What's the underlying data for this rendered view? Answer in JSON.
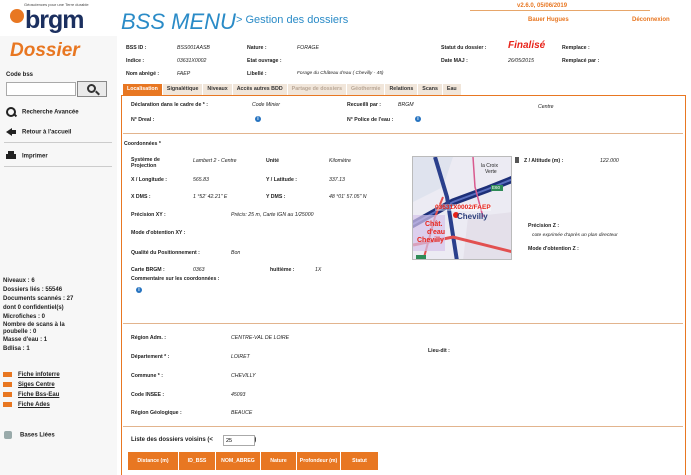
{
  "header": {
    "logo_tagline": "Géosciences pour une Terre durable",
    "logo_text": "brgm",
    "app_title": "BSS MENU",
    "app_subtitle": "> Gestion des dossiers",
    "version": "v2.6.0, 05/06/2019",
    "user": "Bauer Hugues",
    "logout": "Déconnexion"
  },
  "sidebar": {
    "title": "Dossier",
    "codebss_label": "Code bss",
    "codebss_value": "",
    "links": [
      {
        "label": "Recherche Avancée",
        "icon": "search-icon"
      },
      {
        "label": "Retour à l'accueil",
        "icon": "back-arrow-icon"
      },
      {
        "label": "Imprimer",
        "icon": "printer-icon"
      }
    ],
    "stats": [
      "Niveaux : 6",
      "Dossiers liés : 55546",
      "Documents scannés : 27",
      "dont 0 confidentiel(s)",
      "Microfiches : 0",
      "Nombre de scans à la",
      "poubelle : 0",
      "Masse d'eau : 1",
      "Bdlisa : 1"
    ],
    "ext_links": [
      "Fiche infoterre",
      "Siges Centre",
      "Fiche Bss-Eau",
      "Fiche Ades"
    ],
    "bases_label": "Bases Liées"
  },
  "record": {
    "bss_id_label": "BSS ID :",
    "bss_id": "BSS001AASB",
    "indice_label": "Indice :",
    "indice": "03631X0002",
    "nom_label": "Nom abrégé :",
    "nom": "FAEP",
    "nature_label": "Nature :",
    "nature": "FORAGE",
    "etat_label": "Etat ouvrage :",
    "etat": "",
    "libelle_label": "Libellé :",
    "libelle": "Forage du Château d'eau ( Chevilly - 45)",
    "statut_label": "Statut du dossier :",
    "statut": "Finalisé",
    "datemaj_label": "Date MAJ :",
    "datemaj": "26/05/2015",
    "remplace_label": "Remplace :",
    "remplace_par_label": "Remplacé par :"
  },
  "tabs": [
    {
      "label": "Localisation",
      "state": "active"
    },
    {
      "label": "Signalétique",
      "state": "normal"
    },
    {
      "label": "Niveaux",
      "state": "normal"
    },
    {
      "label": "Accès autres BDD",
      "state": "normal"
    },
    {
      "label": "Partage de dossiers",
      "state": "disabled"
    },
    {
      "label": "Géothermie",
      "state": "disabled"
    },
    {
      "label": "Relations",
      "state": "normal"
    },
    {
      "label": "Scans",
      "state": "normal"
    },
    {
      "label": "Eau",
      "state": "normal"
    }
  ],
  "localisation": {
    "declaration_label": "Déclaration dans le cadre de * :",
    "declaration": "Code Minier",
    "recueilli_label": "Recueilli par :",
    "recueilli": "BRGM",
    "recueilli_extra": "Centre",
    "dreal_label": "N° Dreal :",
    "police_label": "N° Police de l'eau :",
    "coord_title": "Coordonnées *",
    "systeme_label": "Système de Projection",
    "systeme": "Lambert 2 - Centre",
    "unite_label": "Unité",
    "unite": "Kilomètre",
    "x_label": "X / Longitude :",
    "x": "565.83",
    "y_label": "Y / Latitude :",
    "y": "337.13",
    "xdms_label": "X DMS :",
    "xdms": "1 °52' 42.21\" E",
    "ydms_label": "Y DMS :",
    "ydms": "48 °01' 57.05\" N",
    "precision_xy_label": "Précision XY :",
    "precision_xy": "Précis: 25 m, Carte IGN au 1/25000",
    "mode_xy_label": "Mode d'obtention XY :",
    "qualite_label": "Qualité du Positionnement :",
    "qualite": "Bon",
    "carte_label": "Carte BRGM :",
    "carte": "0363",
    "huitieme_label": "huitième :",
    "huitieme": "1X",
    "commentaire_label": "Commentaire sur les coordonnées :",
    "z_label": "Z / Altitude (m) :",
    "z": "122.000",
    "precision_z_label": "Précision Z :",
    "precision_z": "cote exprimée d'après un plan directeur",
    "mode_z_label": "Mode d'obtention Z :",
    "map_labels": {
      "place1": "la Croix",
      "place2": "Verte",
      "road": "E60",
      "marker": "03631X0002/FAEP",
      "town": "Chevilly",
      "chat1": "Chât.",
      "chat2": "d'eau",
      "chat3": "Chevilly"
    },
    "region_label": "Région Adm. :",
    "region": "CENTRE-VAL DE LOIRE",
    "dept_label": "Département * :",
    "dept": "LOIRET",
    "lieudit_label": "Lieu-dit :",
    "commune_label": "Commune * :",
    "commune": "CHEVILLY",
    "insee_label": "Code INSEE :",
    "insee": "45093",
    "regiongeo_label": "Région Géologique :",
    "regiongeo": "BEAUCE",
    "neighbors_prefix": "Liste des dossiers voisins (<",
    "neighbors_value": "25",
    "neighbors_suffix": "m)",
    "table_headers": [
      "Distance (m)",
      "ID_BSS",
      "NOM_ABREG",
      "Nature",
      "Profondeur (m)",
      "Statut"
    ]
  },
  "colors": {
    "accent": "#e87722",
    "title_blue": "#2a8bc7",
    "status_red": "#e8231a"
  }
}
